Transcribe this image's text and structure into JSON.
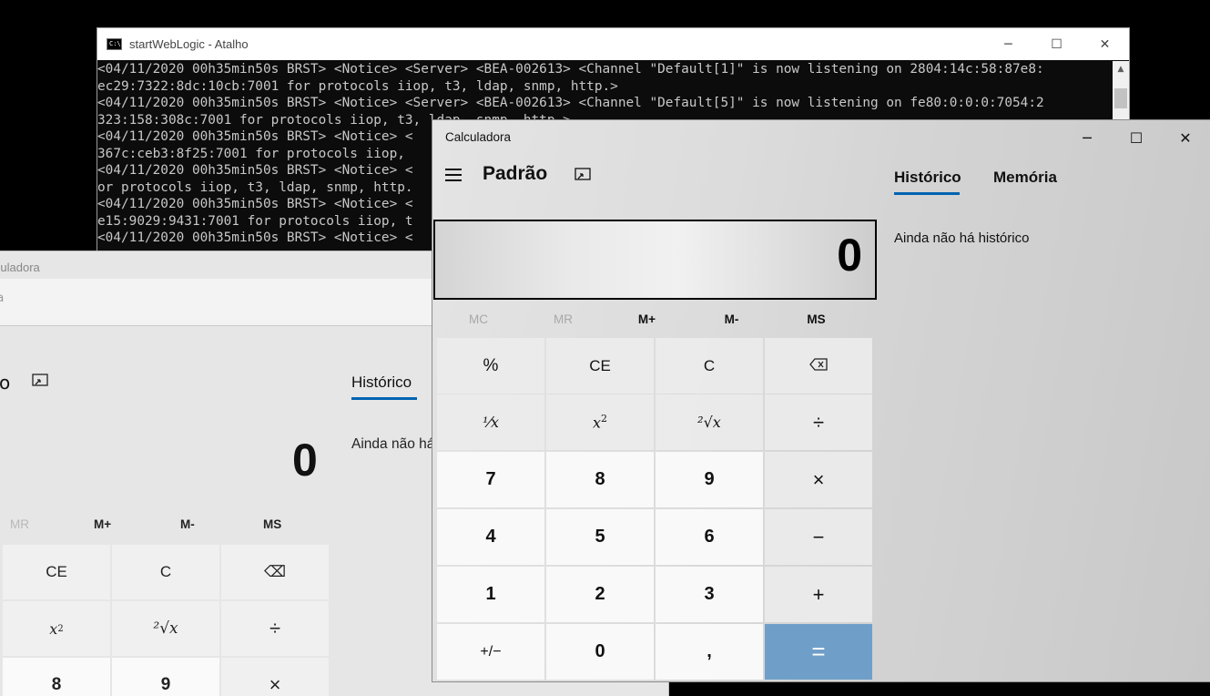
{
  "console": {
    "title": "startWebLogic - Atalho",
    "lines": [
      "<04/11/2020 00h35min50s BRST> <Notice> <Server> <BEA-002613> <Channel \"Default[1]\" is now listening on 2804:14c:58:87e8:",
      "ec29:7322:8dc:10cb:7001 for protocols iiop, t3, ldap, snmp, http.>",
      "<04/11/2020 00h35min50s BRST> <Notice> <Server> <BEA-002613> <Channel \"Default[5]\" is now listening on fe80:0:0:0:7054:2",
      "323:158:308c:7001 for protocols iiop, t3, ldap, snmp, http.>",
      "<04/11/2020 00h35min50s BRST> <Notice> <",
      "367c:ceb3:8f25:7001 for protocols iiop, ",
      "<04/11/2020 00h35min50s BRST> <Notice> <",
      "or protocols iiop, t3, ldap, snmp, http.",
      "<04/11/2020 00h35min50s BRST> <Notice> <",
      "e15:9029:9431:7001 for protocols iiop, t",
      "<04/11/2020 00h35min50s BRST> <Notice> <"
    ]
  },
  "calc_bg": {
    "title": "lculadora",
    "menu_text": "ra",
    "mode_fragment": "o",
    "history_tab": "Histórico",
    "history_empty": "Ainda não há",
    "display": "0",
    "memory": [
      "MR",
      "M+",
      "M-",
      "MS"
    ],
    "keys_row1": [
      "CE",
      "C",
      "⌫"
    ],
    "keys_row2_sq": "x",
    "keys_row2_sq_sup": "2",
    "keys_row2_root": "²√x",
    "keys_row2_div": "÷",
    "keys_row3": [
      "8",
      "9",
      "×"
    ]
  },
  "calc": {
    "title": "Calculadora",
    "mode": "Padrão",
    "tabs": {
      "history": "Histórico",
      "memory": "Memória"
    },
    "history_empty": "Ainda não há histórico",
    "display": "0",
    "memory": [
      "MC",
      "MR",
      "M+",
      "M-",
      "MS"
    ],
    "memory_disabled": [
      true,
      true,
      false,
      false,
      false
    ],
    "keys": {
      "percent": "%",
      "ce": "CE",
      "c": "C",
      "backspace": "⌫",
      "reciprocal": "⅟x",
      "square_base": "x",
      "square_sup": "2",
      "sqrt": "²√x",
      "divide": "÷",
      "seven": "7",
      "eight": "8",
      "nine": "9",
      "multiply": "×",
      "four": "4",
      "five": "5",
      "six": "6",
      "minus": "−",
      "one": "1",
      "two": "2",
      "three": "3",
      "plus": "+",
      "negate": "+/−",
      "zero": "0",
      "decimal": ",",
      "equals": "="
    },
    "accent": "#0063b1",
    "equals_color": "#6f9fc9"
  },
  "window_controls": {
    "minimize": "─",
    "maximize": "☐",
    "close": "✕"
  }
}
